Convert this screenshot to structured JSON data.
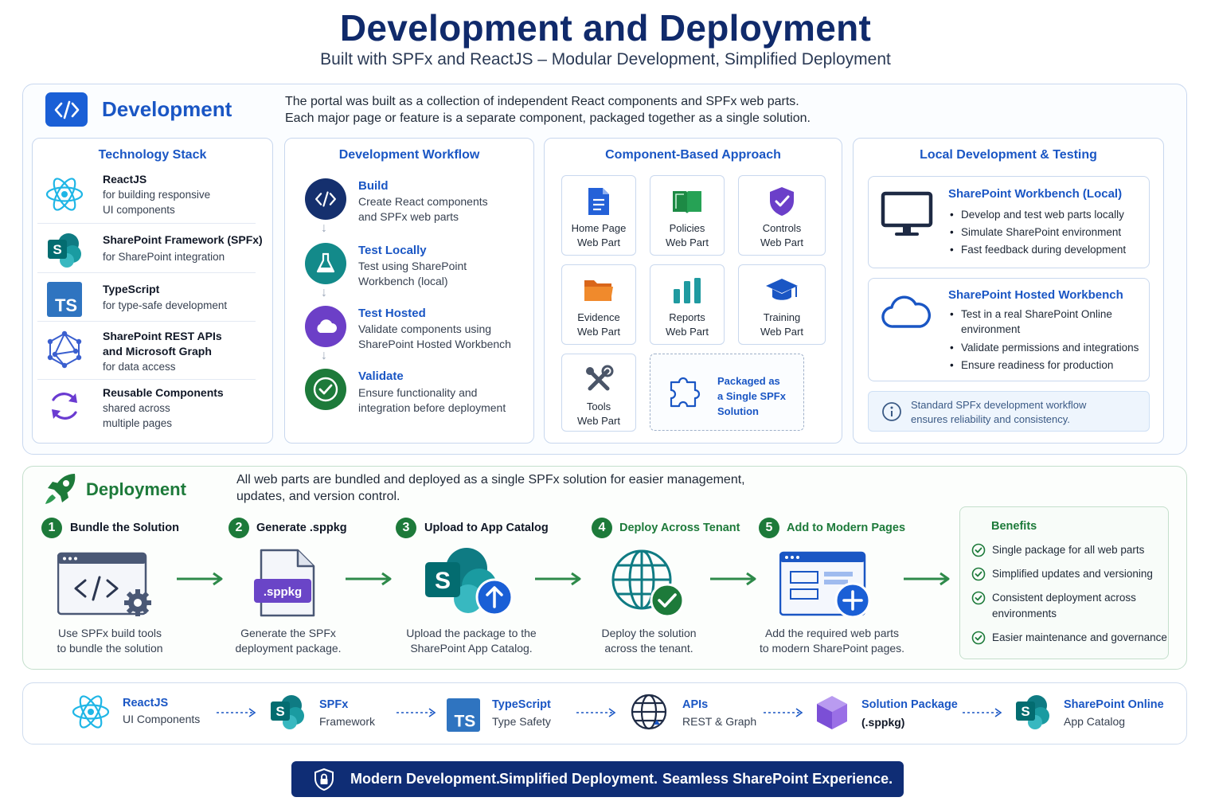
{
  "header": {
    "title": "Development and Deployment",
    "subtitle": "Built with SPFx and ReactJS – Modular Development, Simplified Deployment"
  },
  "development": {
    "title": "Development",
    "description_line1": "The portal was built as a collection of independent React components and SPFx web parts.",
    "description_line2": "Each major page or feature is a separate component, packaged together as a single solution.",
    "tech_stack": {
      "title": "Technology Stack",
      "items": [
        {
          "name": "ReactJS",
          "desc1": "for building responsive",
          "desc2": "UI components",
          "icon": "react-icon"
        },
        {
          "name": "SharePoint Framework (SPFx)",
          "desc1": "for SharePoint integration",
          "desc2": "",
          "icon": "sharepoint-icon"
        },
        {
          "name": "TypeScript",
          "desc1": "for type-safe development",
          "desc2": "",
          "icon": "typescript-icon"
        },
        {
          "name": "SharePoint REST APIs",
          "name2": "and Microsoft Graph",
          "desc1": "for data access",
          "desc2": "",
          "icon": "graph-icon"
        },
        {
          "name": "Reusable Components",
          "desc1": "shared across",
          "desc2": "multiple pages",
          "icon": "refresh-icon"
        }
      ]
    },
    "workflow": {
      "title": "Development Workflow",
      "steps": [
        {
          "name": "Build",
          "desc1": "Create React components",
          "desc2": "and SPFx web parts",
          "icon": "code-icon"
        },
        {
          "name": "Test Locally",
          "desc1": "Test using SharePoint",
          "desc2": "Workbench (local)",
          "icon": "flask-icon"
        },
        {
          "name": "Test Hosted",
          "desc1": "Validate components using",
          "desc2": "SharePoint Hosted Workbench",
          "icon": "cloud-icon"
        },
        {
          "name": "Validate",
          "desc1": "Ensure functionality and",
          "desc2": "integration before deployment",
          "icon": "check-icon"
        }
      ]
    },
    "components": {
      "title": "Component-Based Approach",
      "cards": [
        {
          "name": "Home Page",
          "sub": "Web Part",
          "icon": "document-icon"
        },
        {
          "name": "Policies",
          "sub": "Web Part",
          "icon": "book-icon"
        },
        {
          "name": "Controls",
          "sub": "Web Part",
          "icon": "shield-check-icon"
        },
        {
          "name": "Evidence",
          "sub": "Web Part",
          "icon": "folder-icon"
        },
        {
          "name": "Reports",
          "sub": "Web Part",
          "icon": "bar-chart-icon"
        },
        {
          "name": "Training",
          "sub": "Web Part",
          "icon": "graduation-cap-icon"
        },
        {
          "name": "Tools",
          "sub": "Web Part",
          "icon": "tools-icon"
        }
      ],
      "package_line1": "Packaged as",
      "package_line2": "a Single SPFx",
      "package_line3": "Solution"
    },
    "local_testing": {
      "title": "Local Development & Testing",
      "workbench_local": {
        "title": "SharePoint Workbench (Local)",
        "bullets": [
          "Develop and test web parts locally",
          "Simulate SharePoint environment",
          "Fast feedback during development"
        ]
      },
      "workbench_hosted": {
        "title": "SharePoint Hosted Workbench",
        "bullets": [
          "Test in a real SharePoint Online environment",
          "Validate permissions and integrations",
          "Ensure readiness for production"
        ]
      },
      "note_line1": "Standard SPFx development workflow",
      "note_line2": "ensures reliability and consistency."
    }
  },
  "deployment": {
    "title": "Deployment",
    "description_line1": "All web parts are bundled and deployed as a single SPFx solution for easier management,",
    "description_line2": "updates, and version control.",
    "steps": [
      {
        "num": "1",
        "title": "Bundle the Solution",
        "desc1": "Use SPFx build tools",
        "desc2": "to bundle the solution"
      },
      {
        "num": "2",
        "title": "Generate .sppkg",
        "desc1": "Generate the SPFx",
        "desc2": "deployment package.",
        "badge": ".sppkg"
      },
      {
        "num": "3",
        "title": "Upload to App Catalog",
        "desc1": "Upload the package to the",
        "desc2": "SharePoint App Catalog."
      },
      {
        "num": "4",
        "title": "Deploy Across Tenant",
        "desc1": "Deploy the solution",
        "desc2": "across the tenant."
      },
      {
        "num": "5",
        "title": "Add to Modern Pages",
        "desc1": "Add the required web parts",
        "desc2": "to modern SharePoint pages."
      }
    ],
    "benefits": {
      "title": "Benefits",
      "items": [
        "Single package for all web parts",
        "Simplified updates and versioning",
        "Consistent deployment across environments",
        "Easier maintenance and governance"
      ]
    }
  },
  "flow": [
    {
      "name": "ReactJS",
      "sub": "UI Components"
    },
    {
      "name": "SPFx",
      "sub": "Framework"
    },
    {
      "name": "TypeScript",
      "sub": "Type Safety"
    },
    {
      "name": "APIs",
      "sub": "REST & Graph"
    },
    {
      "name": "Solution Package",
      "sub": "(.sppkg)"
    },
    {
      "name": "SharePoint Online",
      "sub": "App Catalog"
    }
  ],
  "footer": {
    "part1": "Modern Development.",
    "part2": "Simplified Deployment.",
    "part3": "Seamless SharePoint Experience."
  },
  "colors": {
    "navy": "#102a6b",
    "blue": "#1a56c4",
    "green": "#1d7a3a",
    "sharepoint_teal": "#0f7b83",
    "typescript_blue": "#2f74c0",
    "footer_bg": "#0f2d75"
  }
}
